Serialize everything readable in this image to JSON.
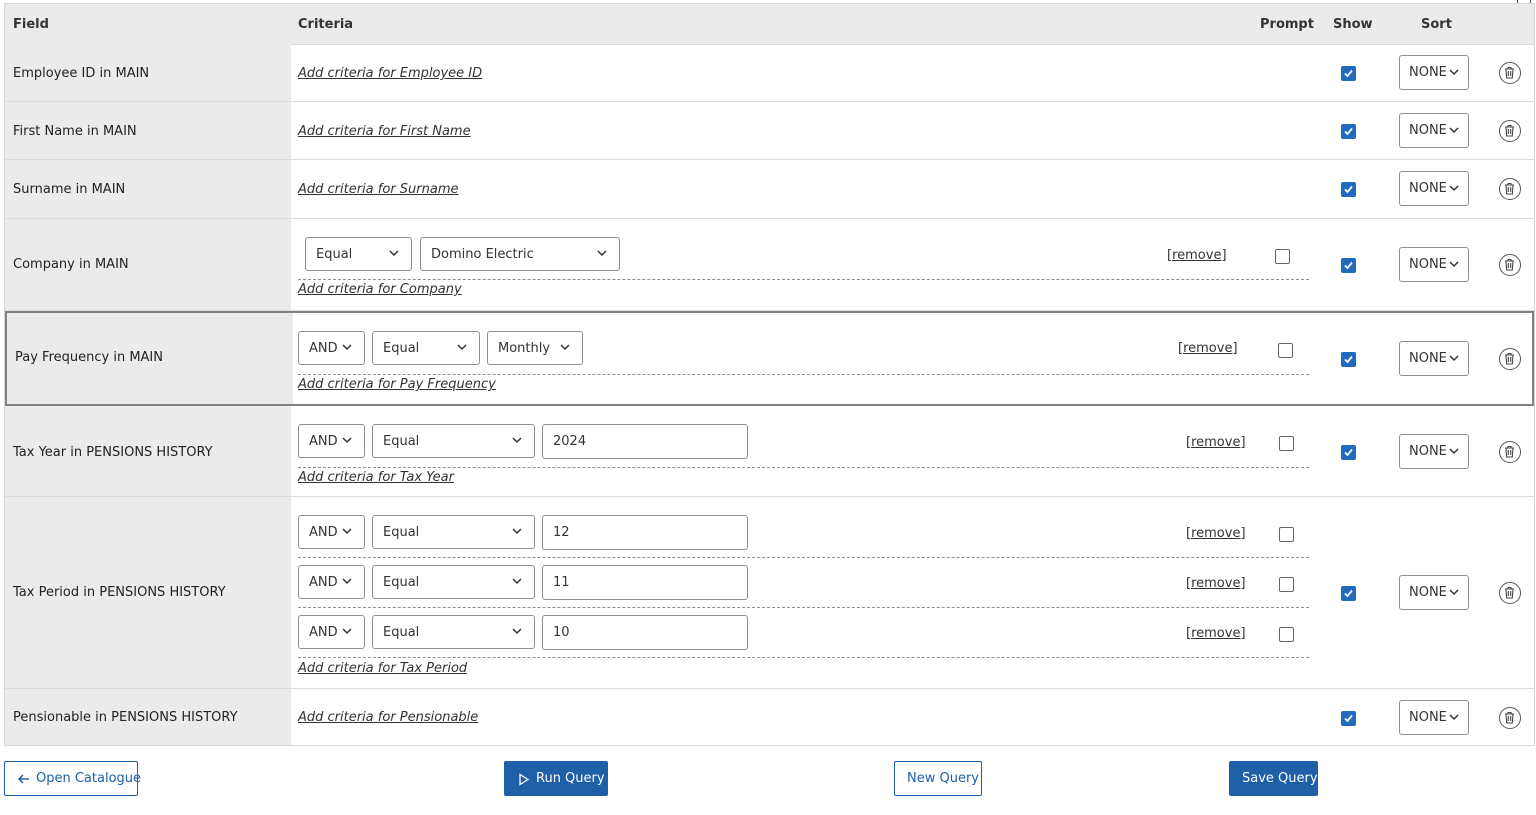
{
  "header": {
    "field": "Field",
    "criteria": "Criteria",
    "prompt": "Prompt",
    "show": "Show",
    "sort": "Sort"
  },
  "rows": [
    {
      "field": "Employee ID in MAIN",
      "add_link": "Add criteria for Employee ID",
      "show": true,
      "sort": "NONE"
    },
    {
      "field": "First Name in MAIN",
      "add_link": "Add criteria for First Name",
      "show": true,
      "sort": "NONE"
    },
    {
      "field": "Surname in MAIN",
      "add_link": "Add criteria for Surname",
      "show": true,
      "sort": "NONE"
    },
    {
      "field": "Company in MAIN",
      "add_link": "Add criteria for Company",
      "show": true,
      "sort": "NONE",
      "criteria": [
        {
          "operator": "Equal",
          "value": "Domino Electric",
          "remove": "[remove]",
          "prompt": false
        }
      ]
    },
    {
      "field": "Pay Frequency in MAIN",
      "add_link": "Add criteria for Pay Frequency",
      "show": true,
      "sort": "NONE",
      "criteria": [
        {
          "conjunction": "AND",
          "operator": "Equal",
          "value": "Monthly",
          "remove": "[remove]",
          "prompt": false
        }
      ]
    },
    {
      "field": "Tax Year in PENSIONS HISTORY",
      "add_link": "Add criteria for Tax Year",
      "show": true,
      "sort": "NONE",
      "criteria": [
        {
          "conjunction": "AND",
          "operator": "Equal",
          "value": "2024",
          "remove": "[remove]",
          "prompt": false
        }
      ]
    },
    {
      "field": "Tax Period in PENSIONS HISTORY",
      "add_link": "Add criteria for Tax Period",
      "show": true,
      "sort": "NONE",
      "criteria": [
        {
          "conjunction": "AND",
          "operator": "Equal",
          "value": "12",
          "remove": "[remove]",
          "prompt": false
        },
        {
          "conjunction": "AND",
          "operator": "Equal",
          "value": "11",
          "remove": "[remove]",
          "prompt": false
        },
        {
          "conjunction": "AND",
          "operator": "Equal",
          "value": "10",
          "remove": "[remove]",
          "prompt": false
        }
      ]
    },
    {
      "field": "Pensionable in PENSIONS HISTORY",
      "add_link": "Add criteria for Pensionable",
      "show": true,
      "sort": "NONE"
    }
  ],
  "footer": {
    "open_catalogue": "Open Catalogue",
    "run_query": "Run Query",
    "new_query": "New Query",
    "save_query": "Save Query"
  },
  "colors": {
    "accent": "#1f5fa8",
    "checkbox": "#1f6bbf",
    "field_bg": "#ebebeb"
  },
  "icons": {
    "back": "arrow-left-icon",
    "run": "play-icon",
    "delete": "trash-icon",
    "dropdown": "chevron-down-icon"
  }
}
